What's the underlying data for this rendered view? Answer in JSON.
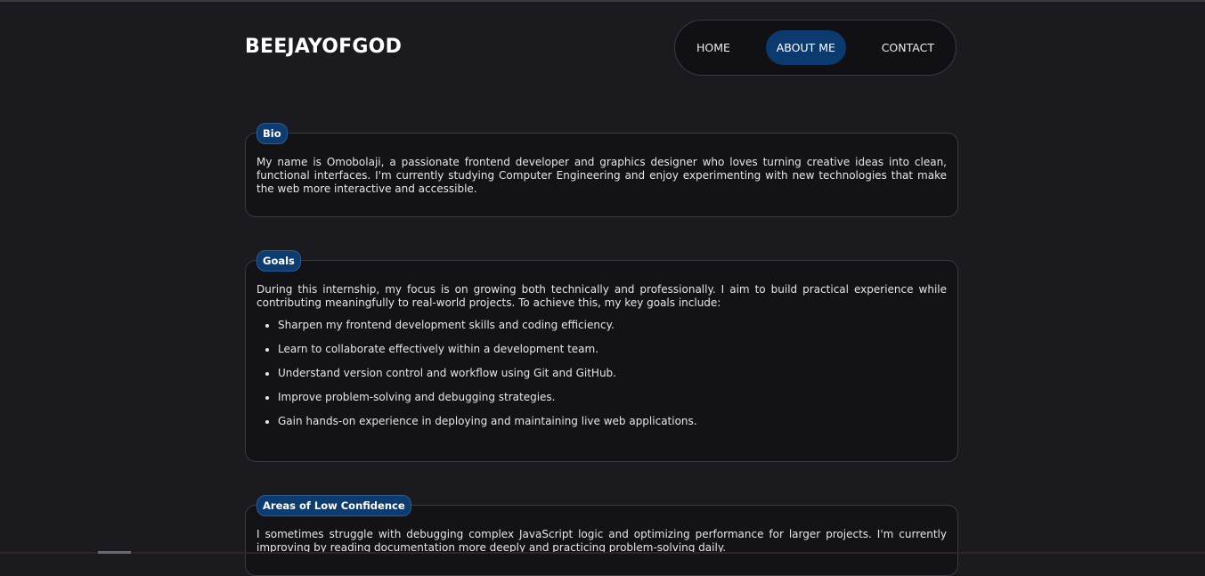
{
  "header": {
    "logo": "BEEJAYOFGOD",
    "nav": [
      {
        "label": "HOME",
        "active": false
      },
      {
        "label": "ABOUT ME",
        "active": true
      },
      {
        "label": "CONTACT",
        "active": false
      }
    ]
  },
  "colors": {
    "background": "#1b1b1f",
    "card": "#131317",
    "accent": "#0c3a6e",
    "border": "#3a3b42"
  },
  "sections": {
    "bio": {
      "title": "Bio",
      "text": "My name is Omobolaji, a passionate frontend developer and graphics designer who loves turning creative ideas into clean, functional interfaces. I'm currently studying Computer Engineering and enjoy experimenting with new technologies that make the web more interactive and accessible."
    },
    "goals": {
      "title": "Goals",
      "intro": "During this internship, my focus is on growing both technically and professionally. I aim to build practical experience while contributing meaningfully to real-world projects. To achieve this, my key goals include:",
      "items": [
        "Sharpen my frontend development skills and coding efficiency.",
        "Learn to collaborate effectively within a development team.",
        "Understand version control and workflow using Git and GitHub.",
        "Improve problem-solving and debugging strategies.",
        "Gain hands-on experience in deploying and maintaining live web applications."
      ]
    },
    "low_confidence": {
      "title": "Areas of Low Confidence",
      "text": "I sometimes struggle with debugging complex JavaScript logic and optimizing performance for larger projects. I'm currently improving by reading documentation more deeply and practicing problem-solving daily."
    }
  }
}
